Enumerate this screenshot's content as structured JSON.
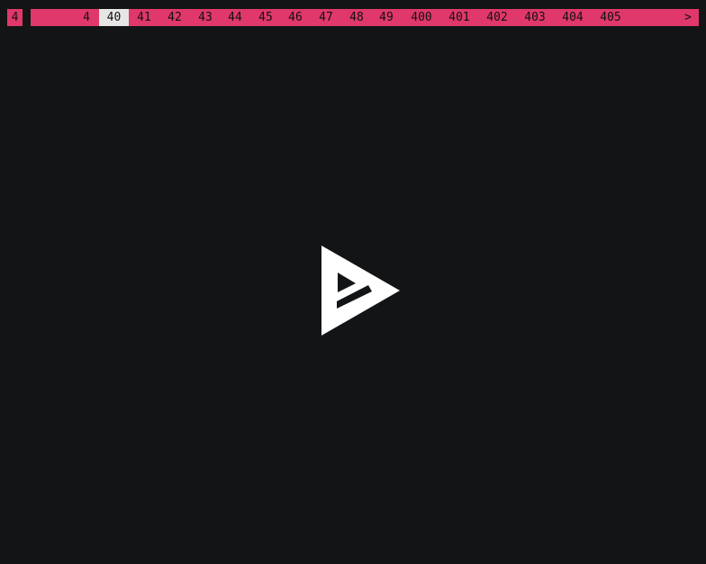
{
  "statusbar": {
    "session": "4",
    "tabs": [
      "4",
      "40",
      "41",
      "42",
      "43",
      "44",
      "45",
      "46",
      "47",
      "48",
      "49",
      "400",
      "401",
      "402",
      "403",
      "404",
      "405"
    ],
    "active_tab": "40",
    "more_indicator": ">",
    "accent_color": "#e0386a",
    "active_color": "#e6e6e6"
  },
  "main": {
    "background": "#131416",
    "logo_icon": "astro-logo-icon"
  }
}
